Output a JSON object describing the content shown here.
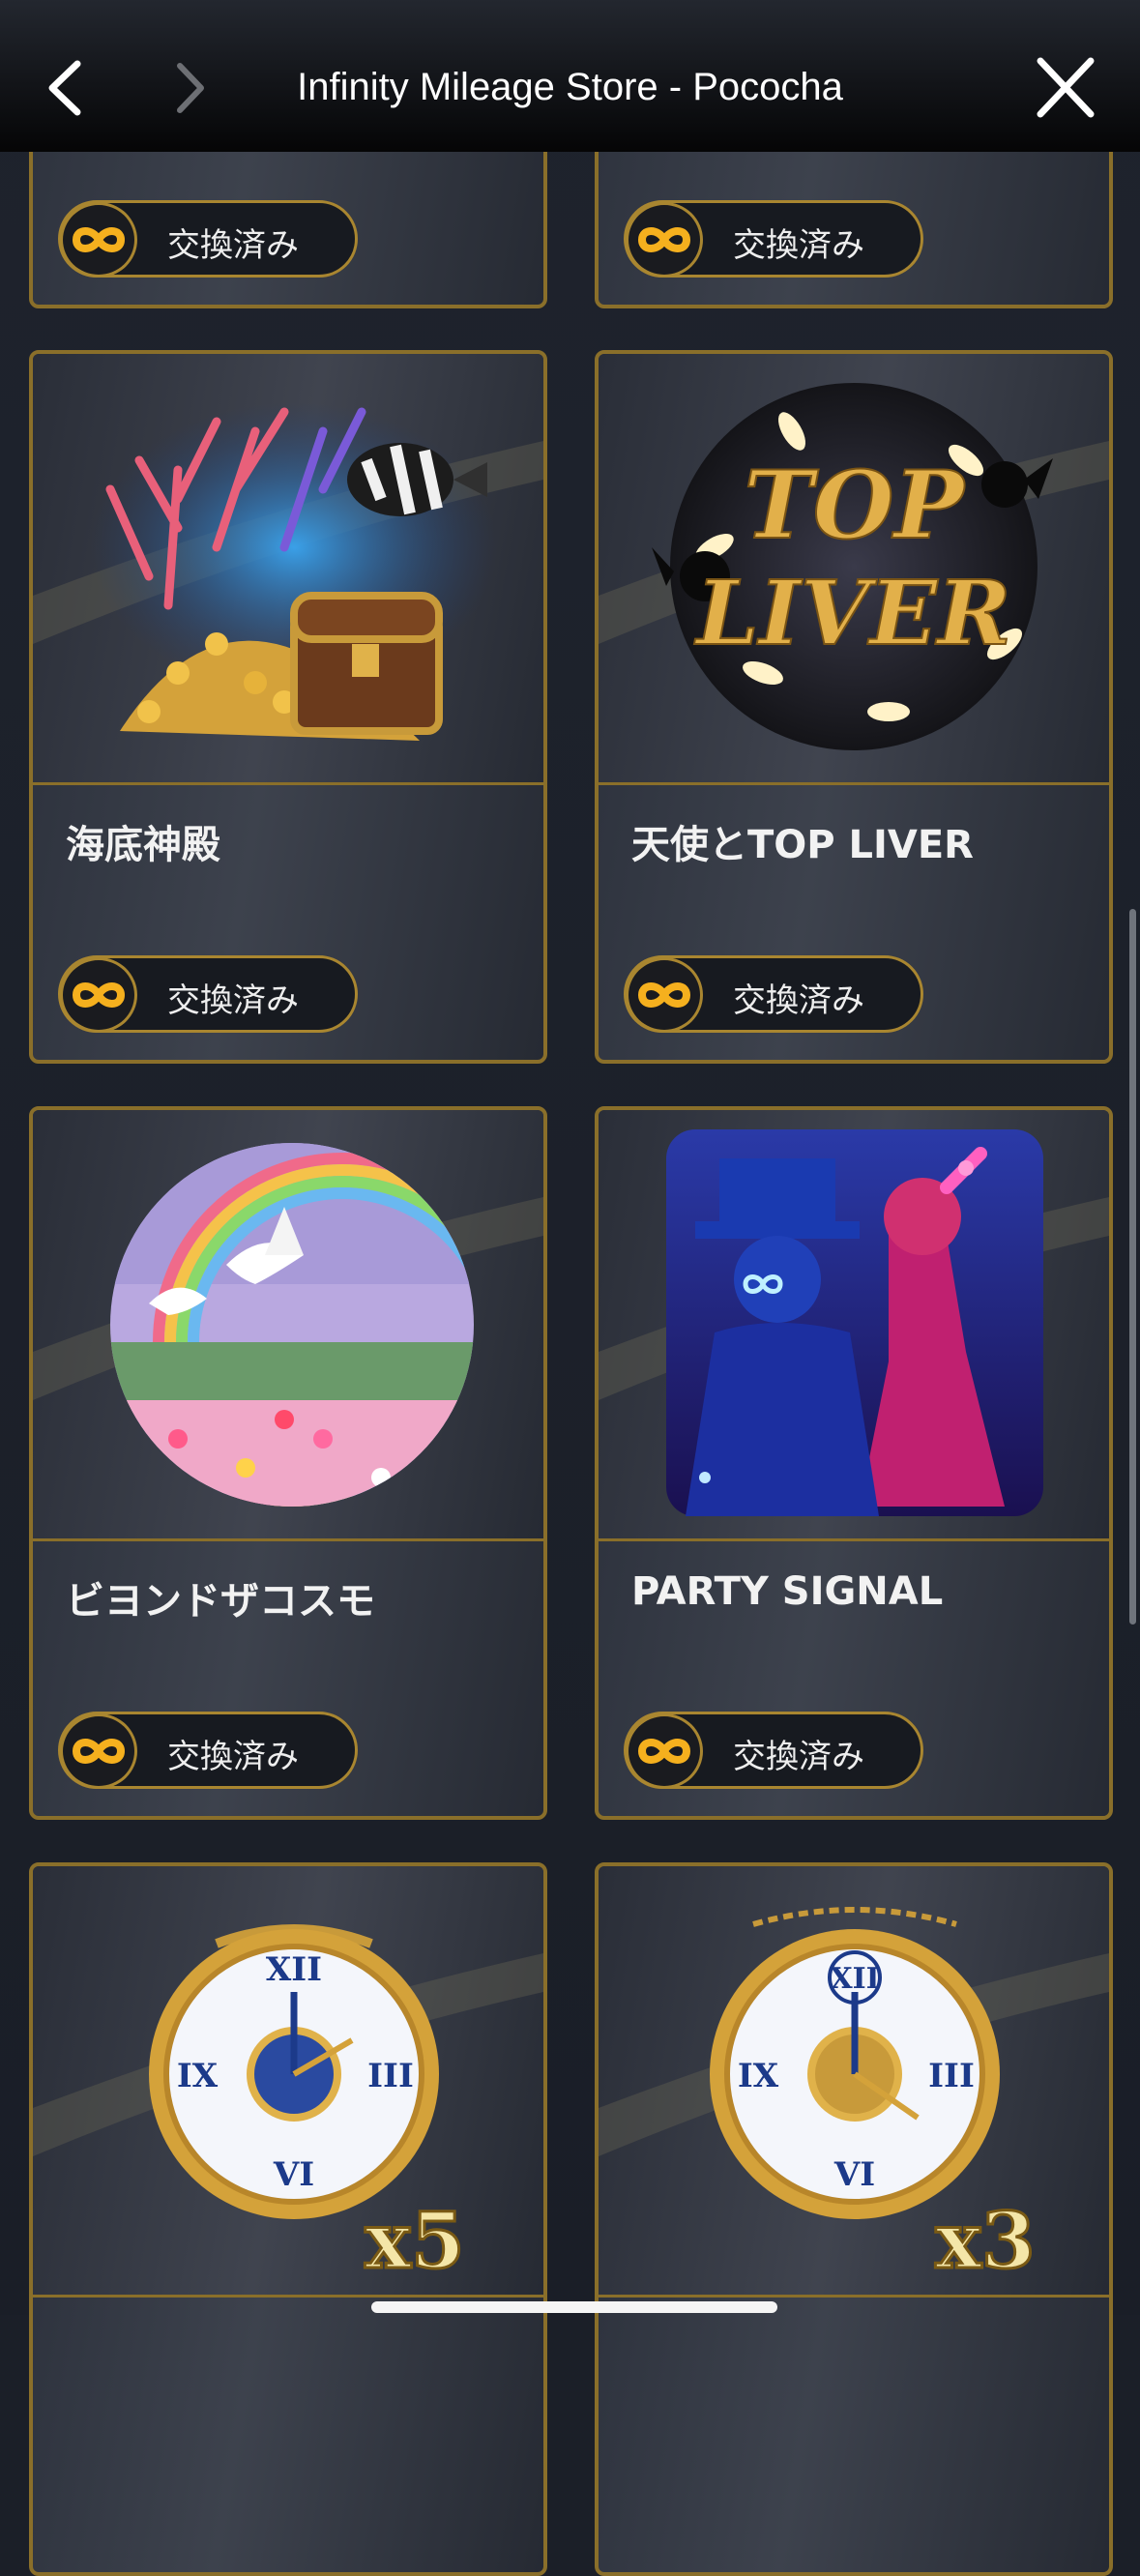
{
  "header": {
    "title": "Infinity Mileage Store - Pococha",
    "back_icon": "chevron-left-icon",
    "forward_icon": "chevron-right-icon",
    "close_icon": "close-icon"
  },
  "colors": {
    "accent_gold": "#a98630",
    "card_border": "#8a6f2a",
    "background": "#1b1f28",
    "infinity_icon": "#f5b01e"
  },
  "items": [
    {
      "title": "",
      "status": "交換済み",
      "art_icon": ""
    },
    {
      "title": "",
      "status": "交換済み",
      "art_icon": ""
    },
    {
      "title": "海底神殿",
      "status": "交換済み",
      "art_icon": "treasure-chest-icon"
    },
    {
      "title": "天使とTOP LIVER",
      "status": "交換済み",
      "art_icon": "top-liver-angels-icon",
      "art_text_1": "TOP",
      "art_text_2": "LIVER"
    },
    {
      "title": "ビヨンドザコスモ",
      "status": "交換済み",
      "art_icon": "rainbow-doves-icon"
    },
    {
      "title": "PARTY SIGNAL",
      "status": "交換済み",
      "art_icon": "party-dancers-icon"
    },
    {
      "title": "",
      "status": "",
      "art_icon": "pocket-watch-icon",
      "art_multiplier": "x5"
    },
    {
      "title": "",
      "status": "",
      "art_icon": "pocket-watch-icon",
      "art_multiplier": "x3"
    }
  ]
}
